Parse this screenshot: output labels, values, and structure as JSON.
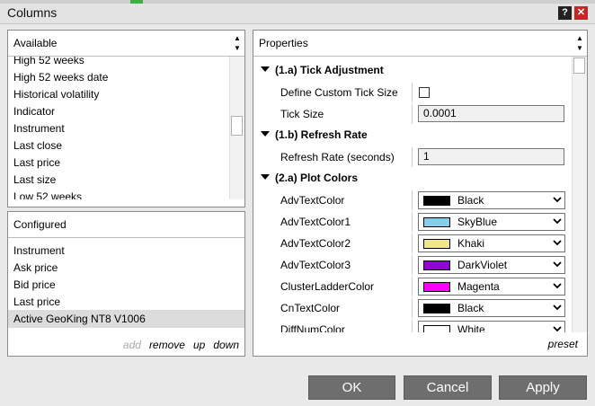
{
  "window": {
    "title": "Columns",
    "help_label": "?",
    "close_label": "✕"
  },
  "available": {
    "header": "Available",
    "items": [
      "High 52 weeks",
      "High 52 weeks date",
      "Historical volatility",
      "Indicator",
      "Instrument",
      "Last close",
      "Last price",
      "Last size",
      "Low 52 weeks"
    ]
  },
  "configured": {
    "header": "Configured",
    "items": [
      "Instrument",
      "Ask price",
      "Bid price",
      "Last price",
      "Active GeoKing NT8 V1006"
    ],
    "selected_index": 4,
    "actions": {
      "add": "add",
      "remove": "remove",
      "up": "up",
      "down": "down"
    }
  },
  "properties": {
    "header": "Properties",
    "categories": {
      "tick": "(1.a) Tick Adjustment",
      "refresh": "(1.b) Refresh Rate",
      "plot": "(2.a) Plot Colors"
    },
    "define_custom_tick_size": {
      "label": "Define Custom Tick Size",
      "checked": false
    },
    "tick_size": {
      "label": "Tick Size",
      "value": "0.0001"
    },
    "refresh_rate": {
      "label": "Refresh Rate (seconds)",
      "value": "1"
    },
    "colors": [
      {
        "label": "AdvTextColor",
        "value": "Black",
        "swatch": "#000000"
      },
      {
        "label": "AdvTextColor1",
        "value": "SkyBlue",
        "swatch": "#87ceeb"
      },
      {
        "label": "AdvTextColor2",
        "value": "Khaki",
        "swatch": "#f0e68c"
      },
      {
        "label": "AdvTextColor3",
        "value": "DarkViolet",
        "swatch": "#9400d3"
      },
      {
        "label": "ClusterLadderColor",
        "value": "Magenta",
        "swatch": "#ff00ff"
      },
      {
        "label": "CnTextColor",
        "value": "Black",
        "swatch": "#000000"
      },
      {
        "label": "DiffNumColor",
        "value": "White",
        "swatch": "#ffffff"
      }
    ],
    "preset_label": "preset"
  },
  "buttons": {
    "ok": "OK",
    "cancel": "Cancel",
    "apply": "Apply"
  }
}
